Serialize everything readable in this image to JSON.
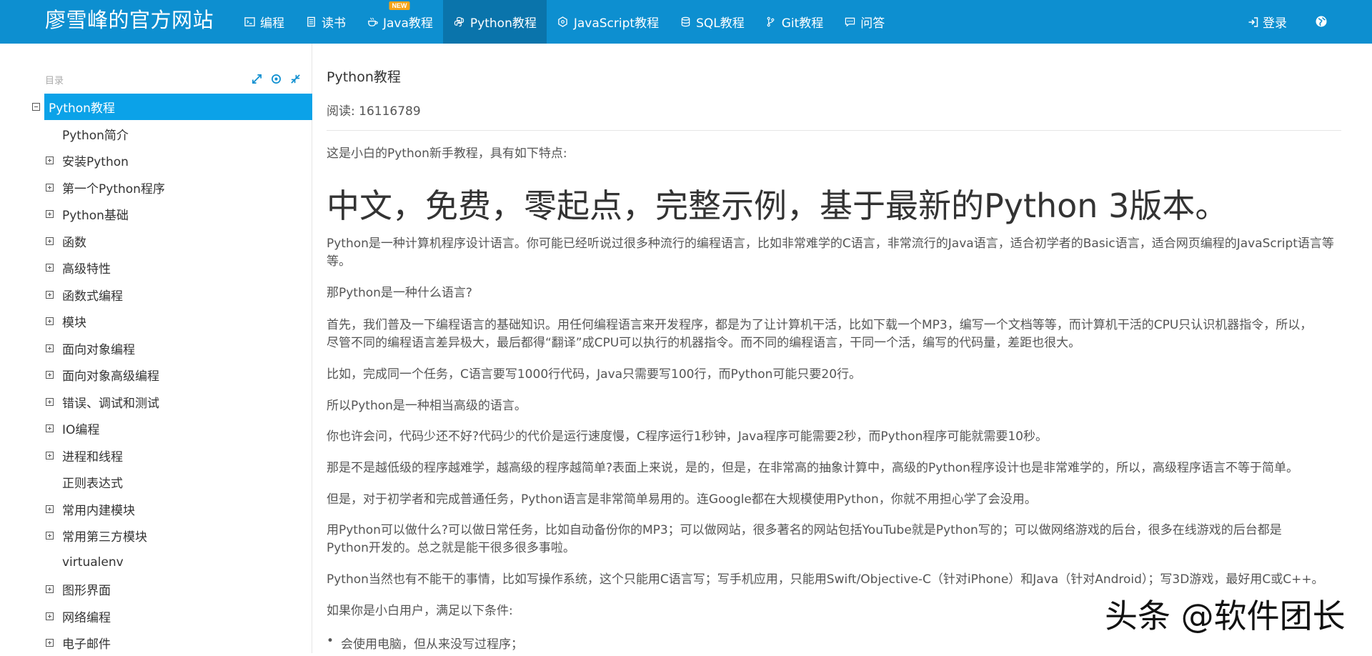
{
  "header": {
    "brand": "廖雪峰的官方网站",
    "nav": [
      {
        "label": "编程",
        "icon": "code-icon"
      },
      {
        "label": "读书",
        "icon": "book-icon"
      },
      {
        "label": "Java教程",
        "icon": "coffee-icon",
        "badge": "NEW"
      },
      {
        "label": "Python教程",
        "icon": "python-icon",
        "active": true
      },
      {
        "label": "JavaScript教程",
        "icon": "hexagon-icon"
      },
      {
        "label": "SQL教程",
        "icon": "database-icon"
      },
      {
        "label": "Git教程",
        "icon": "git-branch-icon"
      },
      {
        "label": "问答",
        "icon": "chat-icon"
      }
    ],
    "login_label": "登录",
    "colors": {
      "bar": "#0d8fd0",
      "active": "#0a74ab",
      "badge": "#f7a418"
    }
  },
  "sidebar": {
    "label": "目录",
    "items": [
      {
        "label": "Python教程",
        "expander": "minus",
        "level": 0
      },
      {
        "label": "Python简介",
        "expander": "none",
        "level": 1
      },
      {
        "label": "安装Python",
        "expander": "plus",
        "level": 1
      },
      {
        "label": "第一个Python程序",
        "expander": "plus",
        "level": 1
      },
      {
        "label": "Python基础",
        "expander": "plus",
        "level": 1
      },
      {
        "label": "函数",
        "expander": "plus",
        "level": 1
      },
      {
        "label": "高级特性",
        "expander": "plus",
        "level": 1
      },
      {
        "label": "函数式编程",
        "expander": "plus",
        "level": 1
      },
      {
        "label": "模块",
        "expander": "plus",
        "level": 1
      },
      {
        "label": "面向对象编程",
        "expander": "plus",
        "level": 1
      },
      {
        "label": "面向对象高级编程",
        "expander": "plus",
        "level": 1
      },
      {
        "label": "错误、调试和测试",
        "expander": "plus",
        "level": 1
      },
      {
        "label": "IO编程",
        "expander": "plus",
        "level": 1
      },
      {
        "label": "进程和线程",
        "expander": "plus",
        "level": 1
      },
      {
        "label": "正则表达式",
        "expander": "none",
        "level": 1
      },
      {
        "label": "常用内建模块",
        "expander": "plus",
        "level": 1
      },
      {
        "label": "常用第三方模块",
        "expander": "plus",
        "level": 1
      },
      {
        "label": "virtualenv",
        "expander": "none",
        "level": 1
      },
      {
        "label": "图形界面",
        "expander": "plus",
        "level": 1
      },
      {
        "label": "网络编程",
        "expander": "plus",
        "level": 1
      },
      {
        "label": "电子邮件",
        "expander": "plus",
        "level": 1
      }
    ],
    "active_color": "#0ba2e8"
  },
  "main": {
    "title": "Python教程",
    "reads": "阅读: 16116789",
    "intro": "这是小白的Python新手教程，具有如下特点:",
    "headline": "中文，免费，零起点，完整示例，基于最新的Python 3版本。",
    "paragraphs": [
      "Python是一种计算机程序设计语言。你可能已经听说过很多种流行的编程语言，比如非常难学的C语言，非常流行的Java语言，适合初学者的Basic语言，适合网页编程的JavaScript语言等等。",
      "那Python是一种什么语言?",
      "首先，我们普及一下编程语言的基础知识。用任何编程语言来开发程序，都是为了让计算机干活，比如下载一个MP3，编写一个文档等等，而计算机干活的CPU只认识机器指令，所以，尽管不同的编程语言差异极大，最后都得“翻译”成CPU可以执行的机器指令。而不同的编程语言，干同一个活，编写的代码量，差距也很大。",
      "比如，完成同一个任务，C语言要写1000行代码，Java只需要写100行，而Python可能只要20行。",
      "所以Python是一种相当高级的语言。",
      "你也许会问，代码少还不好?代码少的代价是运行速度慢，C程序运行1秒钟，Java程序可能需要2秒，而Python程序可能就需要10秒。",
      "那是不是越低级的程序越难学，越高级的程序越简单?表面上来说，是的，但是，在非常高的抽象计算中，高级的Python程序设计也是非常难学的，所以，高级程序语言不等于简单。",
      "但是，对于初学者和完成普通任务，Python语言是非常简单易用的。连Google都在大规模使用Python，你就不用担心学了会没用。",
      "用Python可以做什么?可以做日常任务，比如自动备份你的MP3；可以做网站，很多著名的网站包括YouTube就是Python写的；可以做网络游戏的后台，很多在线游戏的后台都是Python开发的。总之就是能干很多很多事啦。",
      "Python当然也有不能干的事情，比如写操作系统，这个只能用C语言写；写手机应用，只能用Swift/Objective-C（针对iPhone）和Java（针对Android）；写3D游戏，最好用C或C++。",
      "如果你是小白用户，满足以下条件:"
    ],
    "bullets": [
      "会使用电脑，但从来没写过程序；"
    ]
  },
  "watermark": "头条 @软件团长"
}
